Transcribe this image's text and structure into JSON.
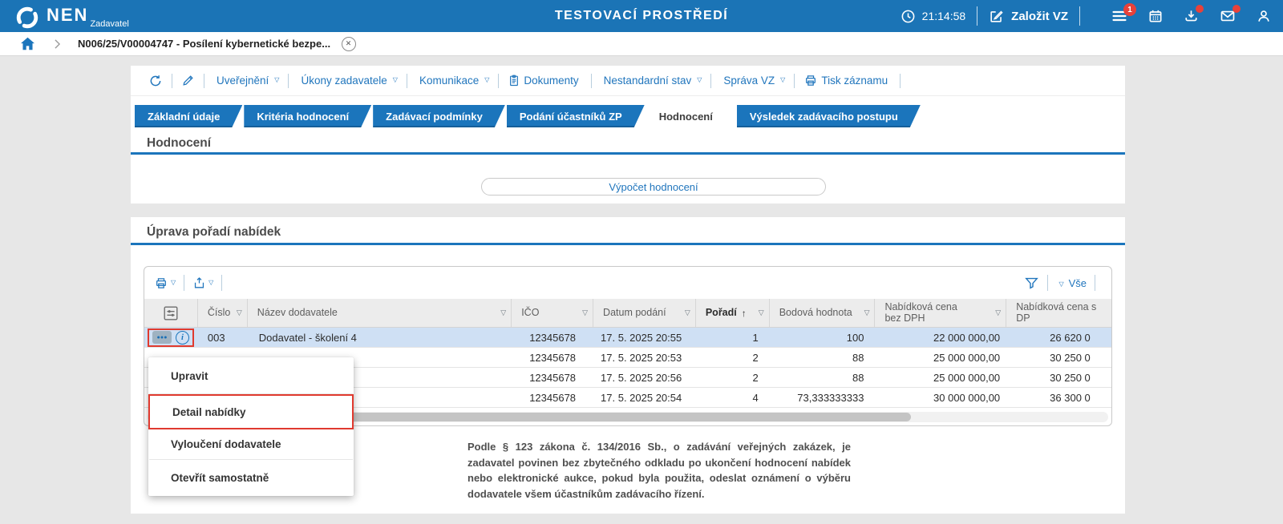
{
  "colors": {
    "accent_blue": "#1b75bc",
    "topbar_blue": "#1b74b6",
    "selected_row": "#cfe0f4",
    "annotation_red": "#e03a2f",
    "badge_red": "#e8413a"
  },
  "topbar": {
    "brand": "NEN",
    "brand_sub": "Zadavatel",
    "env_title": "TESTOVACÍ PROSTŘEDÍ",
    "time": "21:14:58",
    "create_vz_label": "Založit VZ",
    "menu_badge": "1"
  },
  "breadcrumb": {
    "title": "N006/25/V00004747 - Posílení kybernetické bezpe..."
  },
  "toolbar": {
    "items": [
      {
        "label": "Uveřejnění"
      },
      {
        "label": "Úkony zadavatele"
      },
      {
        "label": "Komunikace"
      },
      {
        "label": "Dokumenty"
      },
      {
        "label": "Nestandardní stav"
      },
      {
        "label": "Správa VZ"
      },
      {
        "label": "Tisk záznamu"
      }
    ]
  },
  "tabs": [
    {
      "label": "Základní údaje"
    },
    {
      "label": "Kritéria hodnocení"
    },
    {
      "label": "Zadávací podmínky"
    },
    {
      "label": "Podání účastníků ZP"
    },
    {
      "label": "Hodnocení"
    },
    {
      "label": "Výsledek zadávacího postupu"
    }
  ],
  "evaluation": {
    "title": "Hodnocení",
    "calc_button": "Výpočet hodnocení"
  },
  "order": {
    "title": "Úprava pořadí nabídek",
    "grid": {
      "all_filter": "Vše",
      "columns": [
        "",
        "Číslo",
        "Název dodavatele",
        "IČO",
        "Datum podání",
        "Pořadí",
        "Bodová hodnota",
        "Nabídková cena bez DPH",
        "Nabídková cena s DP"
      ],
      "rows": [
        {
          "cislo": "003",
          "nazev": "Dodavatel - školení 4",
          "ico": "12345678",
          "datum": "17. 5. 2025 20:55",
          "poradi": "1",
          "body": "100",
          "cena_bez": "22 000 000,00",
          "cena_s": "26 620 0"
        },
        {
          "cislo": "",
          "nazev": "",
          "ico": "12345678",
          "datum": "17. 5. 2025 20:53",
          "poradi": "2",
          "body": "88",
          "cena_bez": "25 000 000,00",
          "cena_s": "30 250 0"
        },
        {
          "cislo": "",
          "nazev": "",
          "ico": "12345678",
          "datum": "17. 5. 2025 20:56",
          "poradi": "2",
          "body": "88",
          "cena_bez": "25 000 000,00",
          "cena_s": "30 250 0"
        },
        {
          "cislo": "",
          "nazev": "",
          "ico": "12345678",
          "datum": "17. 5. 2025 20:54",
          "poradi": "4",
          "body": "73,333333333",
          "cena_bez": "30 000 000,00",
          "cena_s": "36 300 0"
        }
      ]
    },
    "note": "Podle § 123 zákona č. 134/2016 Sb., o zadávání veřejných zakázek, je zadavatel povinen bez zbytečného odkladu po ukončení hodnocení nabídek nebo elektronické aukce, pokud byla použita, odeslat oznámení o výběru dodavatele všem účastníkům zadávacího řízení."
  },
  "context_menu": {
    "items": [
      "Upravit",
      "Detail nabídky",
      "Vyloučení dodavatele",
      "Otevřít samostatně"
    ],
    "highlighted": "Detail nabídky"
  }
}
